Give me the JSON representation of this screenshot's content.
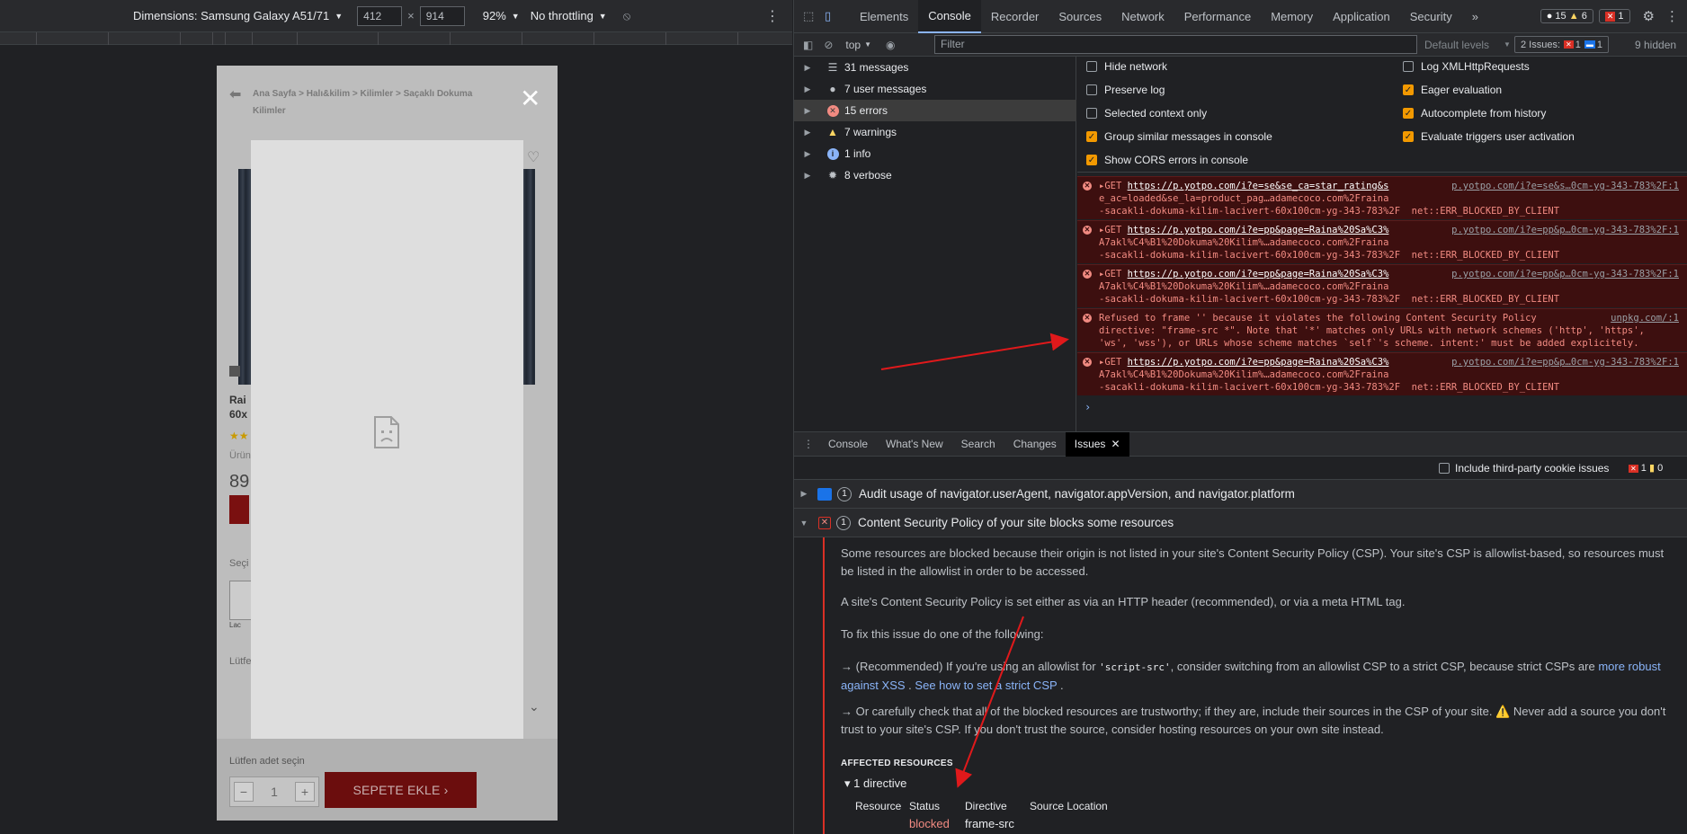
{
  "device_toolbar": {
    "dimensions_label": "Dimensions: Samsung Galaxy A51/71",
    "width": "412",
    "times": "×",
    "height": "914",
    "zoom": "92%",
    "throttling": "No throttling"
  },
  "phone": {
    "breadcrumb": "Ana Sayfa > Halı&kilim > Kilimler > Saçaklı Dokuma Kilimler",
    "close": "✕",
    "title_frag_1": "Rai",
    "title_frag_2": "60x",
    "stars": "★★",
    "urun": "Ürün",
    "price": "89",
    "sect": "Seçi",
    "lac": "Lac",
    "lutfen": "Lütfe",
    "qty_label": "Lütfen adet seçin",
    "qty_minus": "−",
    "qty_value": "1",
    "qty_plus": "+",
    "add_to_cart": "SEPETE EKLE ›"
  },
  "devtools": {
    "tabs": [
      "Elements",
      "Console",
      "Recorder",
      "Sources",
      "Network",
      "Performance",
      "Memory",
      "Application",
      "Security",
      "»"
    ],
    "active_tab": "Console",
    "counts": {
      "errors": "15",
      "warnings": "6",
      "issues": "1"
    },
    "console_toolbar": {
      "context": "top",
      "filter_placeholder": "Filter",
      "levels": "Default levels",
      "issues": "2 Issues:",
      "issues_err": "1",
      "issues_info": "1",
      "hidden": "9 hidden"
    },
    "sidebar": [
      {
        "label": "31 messages",
        "icon": "list-icon",
        "color": "#bdc1c6"
      },
      {
        "label": "7 user messages",
        "icon": "user-icon",
        "color": "#bdc1c6"
      },
      {
        "label": "15 errors",
        "icon": "error-icon",
        "color": "#f28b82"
      },
      {
        "label": "7 warnings",
        "icon": "warning-icon",
        "color": "#fdd663"
      },
      {
        "label": "1 info",
        "icon": "info-icon",
        "color": "#8ab4f8"
      },
      {
        "label": "8 verbose",
        "icon": "bug-icon",
        "color": "#bdc1c6"
      }
    ],
    "settings": {
      "left": [
        {
          "label": "Hide network",
          "checked": false
        },
        {
          "label": "Preserve log",
          "checked": false
        },
        {
          "label": "Selected context only",
          "checked": false
        },
        {
          "label": "Group similar messages in console",
          "checked": true
        },
        {
          "label": "Show CORS errors in console",
          "checked": true
        }
      ],
      "right": [
        {
          "label": "Log XMLHttpRequests",
          "checked": false
        },
        {
          "label": "Eager evaluation",
          "checked": true
        },
        {
          "label": "Autocomplete from history",
          "checked": true
        },
        {
          "label": "Evaluate triggers user activation",
          "checked": true
        }
      ]
    },
    "log": [
      {
        "lines": [
          "▸GET https://p.yotpo.com/i?e=se&se_ca=star_rating&s",
          "e_ac=loaded&se_la=product_pag…adamecoco.com%2Fraina",
          "-sacakli-dokuma-kilim-lacivert-60x100cm-yg-343-783%2F  net::ERR_BLOCKED_BY_CLIENT"
        ],
        "src": "p.yotpo.com/i?e=se&s…0cm-yg-343-783%2F:1"
      },
      {
        "lines": [
          "▸GET https://p.yotpo.com/i?e=pp&page=Raina%20Sa%C3%",
          "A7akl%C4%B1%20Dokuma%20Kilim%…adamecoco.com%2Fraina",
          "-sacakli-dokuma-kilim-lacivert-60x100cm-yg-343-783%2F  net::ERR_BLOCKED_BY_CLIENT"
        ],
        "src": "p.yotpo.com/i?e=pp&p…0cm-yg-343-783%2F:1"
      },
      {
        "lines": [
          "▸GET https://p.yotpo.com/i?e=pp&page=Raina%20Sa%C3%",
          "A7akl%C4%B1%20Dokuma%20Kilim%…adamecoco.com%2Fraina",
          "-sacakli-dokuma-kilim-lacivert-60x100cm-yg-343-783%2F  net::ERR_BLOCKED_BY_CLIENT"
        ],
        "src": "p.yotpo.com/i?e=pp&p…0cm-yg-343-783%2F:1"
      },
      {
        "lines": [
          "Refused to frame '' because it violates the following Content Security Policy",
          "directive: \"frame-src *\". Note that '*' matches only URLs with network schemes ('http', 'https',",
          "'ws', 'wss'), or URLs whose scheme matches `self`'s scheme. intent:' must be added explicitely."
        ],
        "src": "unpkg.com/:1"
      },
      {
        "lines": [
          "▸GET https://p.yotpo.com/i?e=pp&page=Raina%20Sa%C3%",
          "A7akl%C4%B1%20Dokuma%20Kilim%…adamecoco.com%2Fraina",
          "-sacakli-dokuma-kilim-lacivert-60x100cm-yg-343-783%2F  net::ERR_BLOCKED_BY_CLIENT"
        ],
        "src": "p.yotpo.com/i?e=pp&p…0cm-yg-343-783%2F:1"
      }
    ],
    "prompt": "›",
    "drawer_tabs": [
      "Console",
      "What's New",
      "Search",
      "Changes",
      "Issues"
    ],
    "drawer_active": "Issues",
    "drawer_close": "✕",
    "include_third_party": "Include third-party cookie issues",
    "drawer_counts": {
      "err": "1",
      "warn": "0"
    },
    "issues": [
      {
        "count": "1",
        "title": "Audit usage of navigator.userAgent, navigator.appVersion, and navigator.platform",
        "expanded": false
      },
      {
        "count": "1",
        "title": "Content Security Policy of your site blocks some resources",
        "expanded": true
      }
    ],
    "issue_body": {
      "p1": "Some resources are blocked because their origin is not listed in your site's Content Security Policy (CSP). Your site's CSP is allowlist-based, so resources must be listed in the allowlist in order to be accessed.",
      "p2": "A site's Content Security Policy is set either as via an HTTP header (recommended), or via a meta HTML tag.",
      "p3": "To fix this issue do one of the following:",
      "p4a": "→ (Recommended) If you're using an allowlist for",
      "p4code": "'script-src'",
      "p4b": ", consider switching from an allowlist CSP to a strict CSP, because strict CSPs are",
      "p4link1": "more robust against XSS",
      "p4dot": ".",
      "p4link2": "See how to set a strict CSP",
      "p4end": ".",
      "p5": "→ Or carefully check that all of the blocked resources are trustworthy; if they are, include their sources in the CSP of your site. ⚠️ Never add a source you don't trust to your site's CSP. If you don't trust the source, consider hosting resources on your own site instead.",
      "affected": "AFFECTED RESOURCES",
      "directive_toggle": "▾ 1 directive",
      "columns": [
        "Resource",
        "Status",
        "Directive",
        "Source Location"
      ],
      "row": {
        "status": "blocked",
        "directive": "frame-src"
      }
    }
  },
  "colors": {
    "error": "#f28b82",
    "accent": "#8ab4f8",
    "checkbox": "#f29900",
    "annotation_arrow": "#e0191b"
  }
}
